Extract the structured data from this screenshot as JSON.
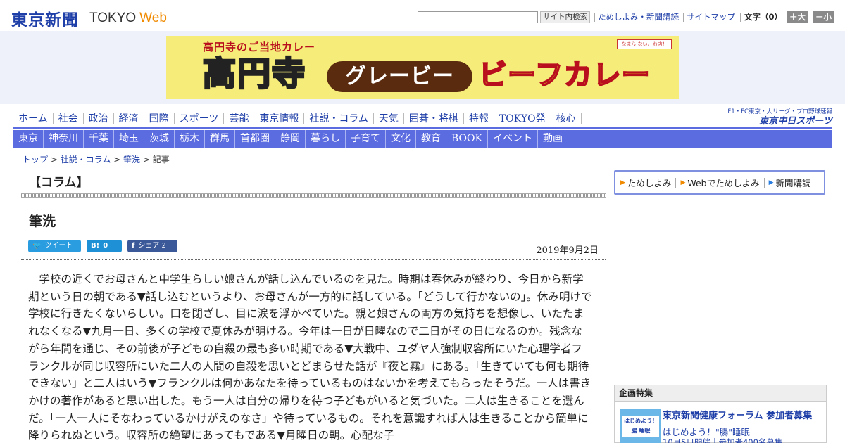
{
  "header": {
    "logo_jp": "東京新聞",
    "logo_en": "TOKYO",
    "logo_web": "Web",
    "search_button": "サイト内検索",
    "links": [
      "ためしよみ・新聞講読",
      "サイトマップ"
    ],
    "font_size_label": "文字（0）",
    "font_bigger": "＋大",
    "font_smaller": "－小"
  },
  "ad": {
    "sub": "高円寺のご当地カレー",
    "main": "高円寺",
    "pill": "グレービー",
    "beef": "ビーフカレー",
    "tag": "なまら ない、お店！"
  },
  "nav_main": [
    "ホーム",
    "社会",
    "政治",
    "経済",
    "国際",
    "スポーツ",
    "芸能",
    "東京情報",
    "社説・コラム",
    "天気",
    "囲碁・将棋",
    "特報",
    "TOKYO発",
    "核心"
  ],
  "nav_side": {
    "line1": "F1・FC東京・大リーグ・プロ野球速報",
    "line2": "東京中日スポーツ"
  },
  "nav_region": [
    "東京",
    "神奈川",
    "千葉",
    "埼玉",
    "茨城",
    "栃木",
    "群馬",
    "首都圏",
    "静岡",
    "暮らし",
    "子育て",
    "文化",
    "教育",
    "BOOK",
    "イベント",
    "動画"
  ],
  "breadcrumb": {
    "top": "トップ",
    "sep": " > ",
    "section": "社説・コラム",
    "sub": "筆洗",
    "current": "記事"
  },
  "article": {
    "section": "【コラム】",
    "title": "筆洗",
    "date": "2019年9月2日",
    "share": {
      "tweet": "ツイート",
      "hatena_count": "0",
      "facebook": "シェア",
      "facebook_count": "2"
    },
    "body": "学校の近くでお母さんと中学生らしい娘さんが話し込んでいるのを見た。時期は春休みが終わり、今日から新学期という日の朝である▼話し込むというより、お母さんが一方的に話している。「どうして行かないの」。休み明けで学校に行きたくないらしい。口を閉ざし、目に涙を浮かべていた。親と娘さんの両方の気持ちを想像し、いたたまれなくなる▼九月一日、多くの学校で夏休みが明ける。今年は一日が日曜なので二日がその日になるのか。残念ながら年間を通じ、その前後が子どもの自殺の最も多い時期である▼大戦中、ユダヤ人強制収容所にいた心理学者フランクルが同じ収容所にいた二人の人間の自殺を思いとどまらせた話が『夜と霧』にある。「生きていても何も期待できない」と二人はいう▼フランクルは何かあなたを待っているものはないかを考えてもらったそうだ。一人は書きかけの著作があると思い出した。もう一人は自分の帰りを待つ子どもがいると気づいた。二人は生きることを選んだ。「一人一人にそなわっているかけがえのなさ」や待っているもの。それを意識すれば人は生きることから簡単に降りられぬという。収容所の絶望にあってもである▼月曜日の朝。心配な子"
  },
  "promo": [
    "ためしよみ",
    "Webでためしよみ",
    "新聞購読"
  ],
  "feature": {
    "header": "企画特集",
    "title": "東京新聞健康フォーラム 参加者募集",
    "thumb": "はじめよう！腸 睡眠",
    "sub": "はじめよう！\"腸\"睡眠",
    "sub2": "10月5日開催｜参加者400名募集"
  }
}
